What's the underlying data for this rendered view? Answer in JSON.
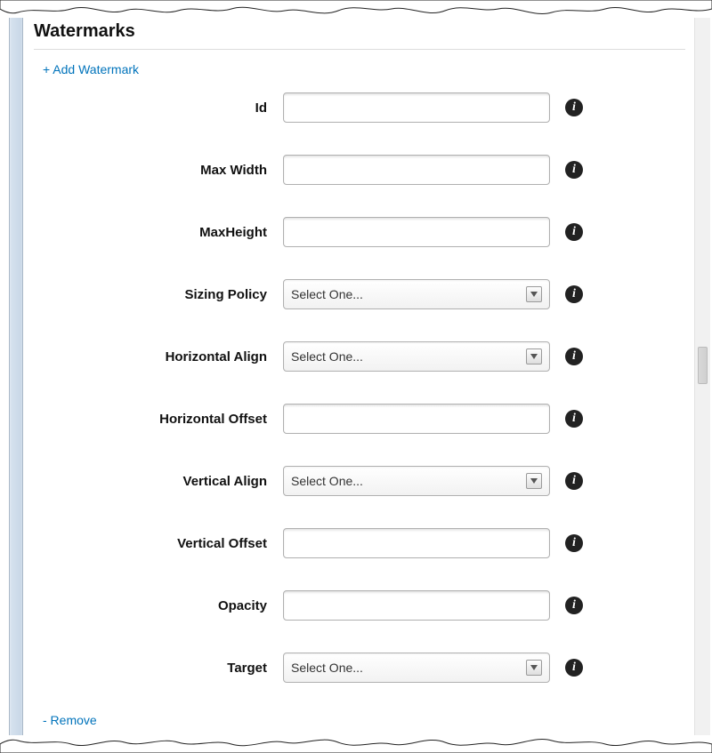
{
  "section": {
    "title": "Watermarks",
    "add_link": "+ Add Watermark",
    "remove_link": "- Remove"
  },
  "select_placeholder": "Select One...",
  "info_glyph": "i",
  "fields": [
    {
      "key": "id",
      "label": "Id",
      "type": "text",
      "value": ""
    },
    {
      "key": "max_width",
      "label": "Max Width",
      "type": "text",
      "value": ""
    },
    {
      "key": "max_height",
      "label": "MaxHeight",
      "type": "text",
      "value": ""
    },
    {
      "key": "sizing_policy",
      "label": "Sizing Policy",
      "type": "select",
      "value": "Select One..."
    },
    {
      "key": "horizontal_align",
      "label": "Horizontal Align",
      "type": "select",
      "value": "Select One..."
    },
    {
      "key": "horizontal_offset",
      "label": "Horizontal Offset",
      "type": "text",
      "value": ""
    },
    {
      "key": "vertical_align",
      "label": "Vertical Align",
      "type": "select",
      "value": "Select One..."
    },
    {
      "key": "vertical_offset",
      "label": "Vertical Offset",
      "type": "text",
      "value": ""
    },
    {
      "key": "opacity",
      "label": "Opacity",
      "type": "text",
      "value": ""
    },
    {
      "key": "target",
      "label": "Target",
      "type": "select",
      "value": "Select One..."
    }
  ]
}
